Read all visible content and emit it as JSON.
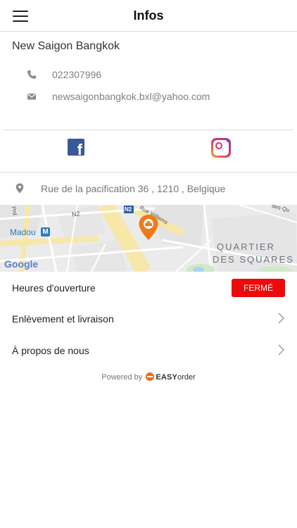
{
  "header": {
    "title": "Infos",
    "menu_icon": "hamburger-menu-icon"
  },
  "restaurant": {
    "name": "New Saigon Bangkok",
    "phone": "022307996",
    "email": "newsaigonbangkok.bxl@yahoo.com",
    "address": "Rue de la pacification 36 , 1210 , Belgique"
  },
  "social": {
    "facebook_icon": "facebook-icon",
    "instagram_icon": "instagram-icon"
  },
  "map": {
    "labels": {
      "madou": "Madou",
      "metro": "M",
      "n2": "N2",
      "n2_badge": "N2",
      "rue": "Rue Willems",
      "quartier1": "QUARTIER",
      "quartier2": "DES SQUARES",
      "google": "Google",
      "rue_top": "des Qu",
      "prd": "Prd"
    },
    "pin_color": "#f07a1a"
  },
  "menu": {
    "hours_label": "Heures d'ouverture",
    "hours_status": "FERMÉ",
    "pickup_label": "Enlèvement et livraison",
    "about_label": "À propos de nous"
  },
  "footer": {
    "powered_by": "Powered by",
    "brand_bold": "EASY",
    "brand_rest": "order"
  },
  "colors": {
    "closed_badge": "#ee0a0a",
    "pin": "#f07a1a",
    "facebook": "#3b5998"
  }
}
